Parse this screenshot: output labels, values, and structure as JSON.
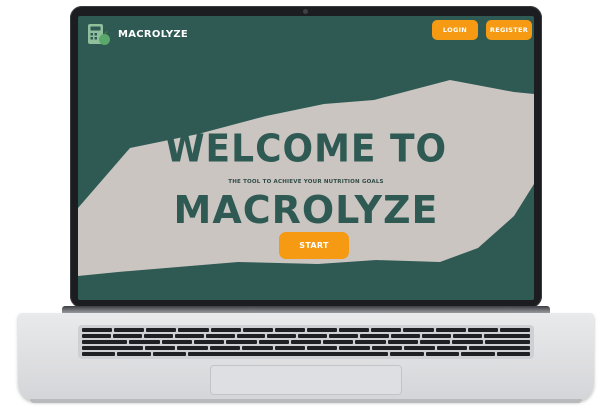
{
  "header": {
    "brand": "MACROLYZE",
    "login_label": "LOGIN",
    "register_label": "REGISTER"
  },
  "hero": {
    "line1": "WELCOME TO",
    "tagline": "THE TOOL TO ACHIEVE YOUR NUTRITION GOALS",
    "line2": "MACROLYZE",
    "start_label": "START"
  },
  "colors": {
    "background": "#2e5a53",
    "blob": "#cbc5c2",
    "accent": "#f59a12",
    "hero_text": "#2e5a53"
  },
  "icons": {
    "logo": "calculator-apple-logo-icon"
  }
}
